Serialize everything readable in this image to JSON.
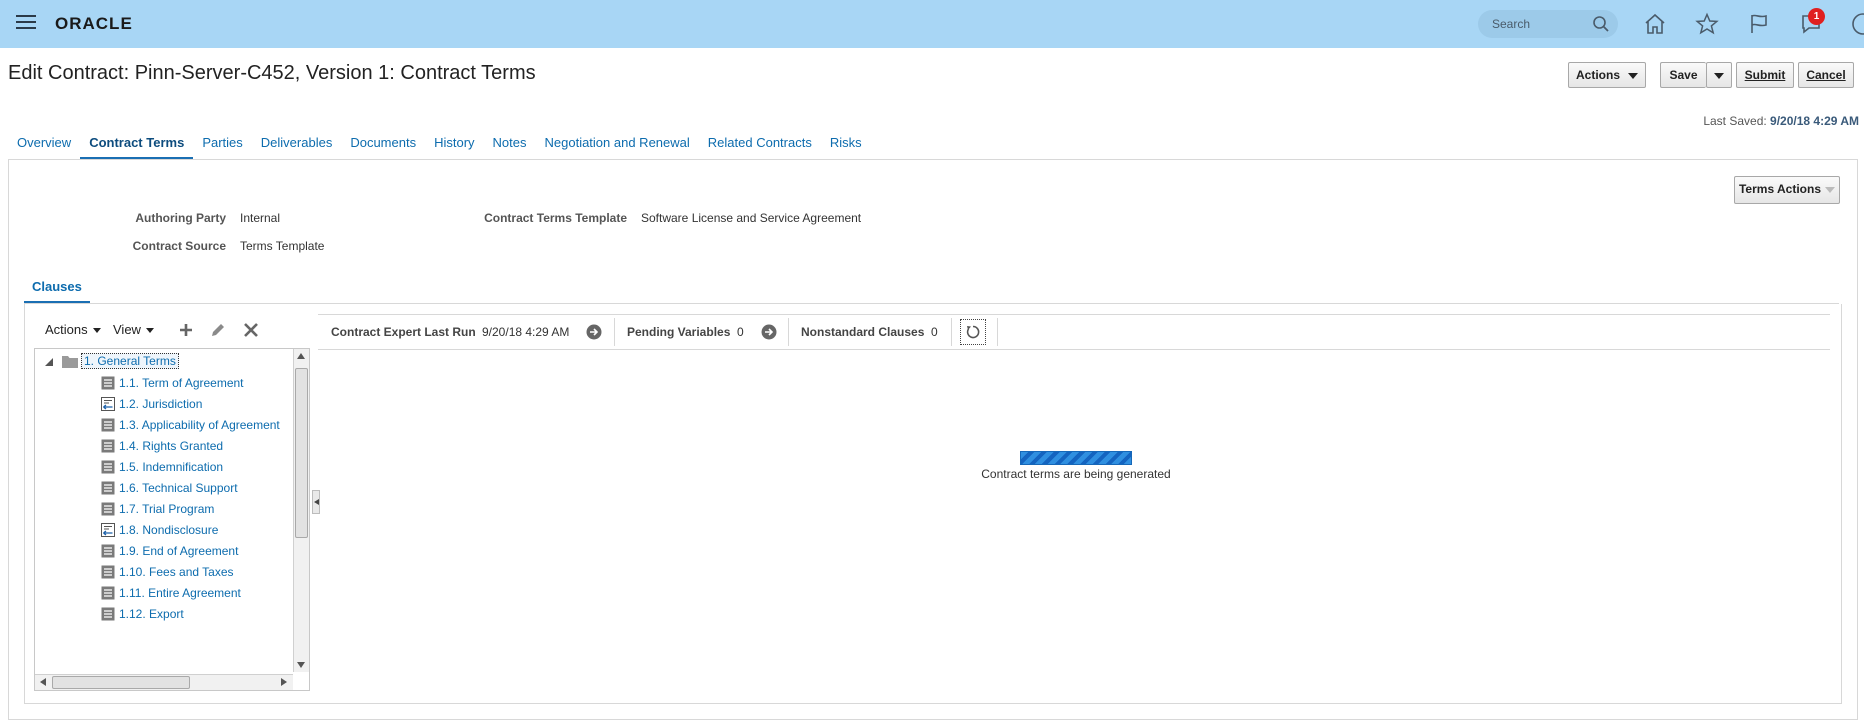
{
  "header": {
    "brand": "ORACLE",
    "search_placeholder": "Search",
    "notification_count": "1",
    "colors": {
      "bar": "#a8d6f5",
      "badge": "#e02020"
    }
  },
  "page": {
    "title": "Edit Contract: Pinn-Server-C452, Version 1: Contract Terms",
    "buttons": {
      "actions": "Actions",
      "save": "Save",
      "submit": "Submit",
      "cancel": "Cancel"
    },
    "last_saved_label": "Last Saved:",
    "last_saved_value": "9/20/18 4:29 AM"
  },
  "tabs": [
    {
      "label": "Overview"
    },
    {
      "label": "Contract Terms",
      "active": true
    },
    {
      "label": "Parties"
    },
    {
      "label": "Deliverables"
    },
    {
      "label": "Documents"
    },
    {
      "label": "History"
    },
    {
      "label": "Notes"
    },
    {
      "label": "Negotiation and Renewal"
    },
    {
      "label": "Related Contracts"
    },
    {
      "label": "Risks"
    }
  ],
  "terms": {
    "actions_button": "Terms Actions",
    "authoring_party_label": "Authoring Party",
    "authoring_party_value": "Internal",
    "contract_source_label": "Contract Source",
    "contract_source_value": "Terms Template",
    "template_label": "Contract Terms Template",
    "template_value": "Software License and Service Agreement"
  },
  "clauses": {
    "tab_label": "Clauses",
    "toolbar": {
      "actions": "Actions",
      "view": "View"
    },
    "tree_root": "1. General Terms",
    "items": [
      {
        "label": "1.1. Term of Agreement",
        "icon": "clause-icon"
      },
      {
        "label": "1.2. Jurisdiction",
        "icon": "alternate-clause-icon"
      },
      {
        "label": "1.3. Applicability of Agreement",
        "icon": "clause-icon"
      },
      {
        "label": "1.4. Rights Granted",
        "icon": "clause-icon"
      },
      {
        "label": "1.5. Indemnification",
        "icon": "clause-icon"
      },
      {
        "label": "1.6. Technical Support",
        "icon": "clause-icon"
      },
      {
        "label": "1.7. Trial Program",
        "icon": "clause-icon"
      },
      {
        "label": "1.8. Nondisclosure",
        "icon": "alternate-clause-icon"
      },
      {
        "label": "1.9. End of Agreement",
        "icon": "clause-icon"
      },
      {
        "label": "1.10. Fees and Taxes",
        "icon": "clause-icon"
      },
      {
        "label": "1.11. Entire Agreement",
        "icon": "clause-icon"
      },
      {
        "label": "1.12. Export",
        "icon": "clause-icon"
      }
    ],
    "expert_last_run_label": "Contract Expert Last Run",
    "expert_last_run_value": "9/20/18 4:29 AM",
    "pending_variables_label": "Pending Variables",
    "pending_variables_value": "0",
    "nonstandard_clauses_label": "Nonstandard Clauses",
    "nonstandard_clauses_value": "0",
    "progress_text": "Contract terms are being generated"
  }
}
